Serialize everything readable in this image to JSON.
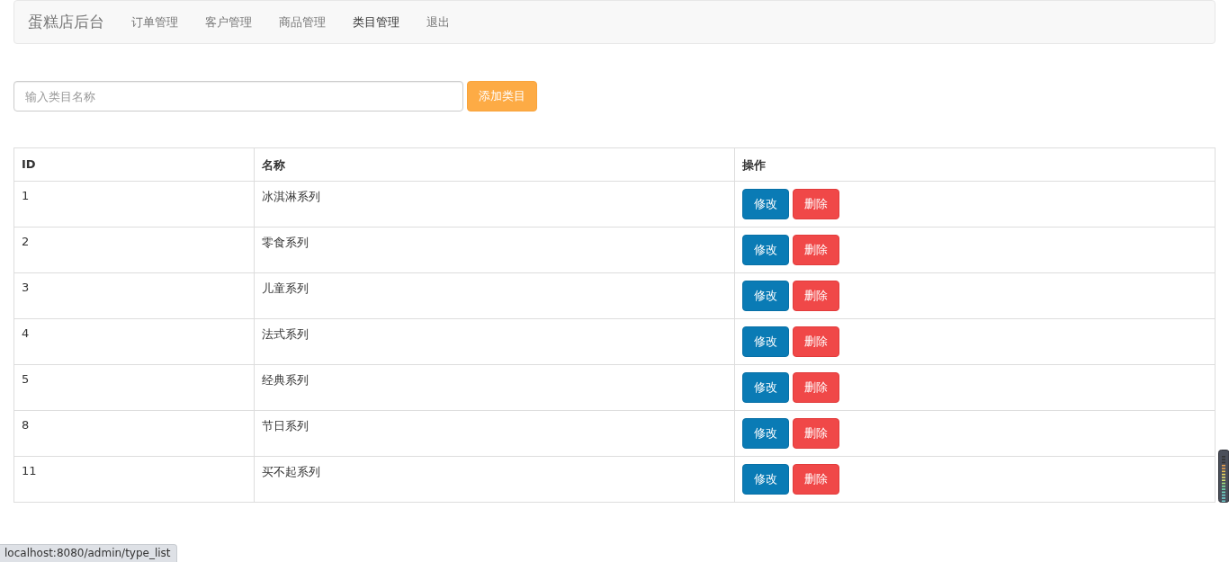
{
  "navbar": {
    "brand": "蛋糕店后台",
    "items": [
      {
        "label": "订单管理",
        "selected": false
      },
      {
        "label": "客户管理",
        "selected": false
      },
      {
        "label": "商品管理",
        "selected": false
      },
      {
        "label": "类目管理",
        "selected": true
      },
      {
        "label": "退出",
        "selected": false
      }
    ]
  },
  "add_form": {
    "placeholder": "输入类目名称",
    "button": "添加类目"
  },
  "table": {
    "columns": [
      "ID",
      "名称",
      "操作"
    ],
    "rows": [
      {
        "id": "1",
        "name": "冰淇淋系列",
        "actions": [
          "修改",
          "删除"
        ]
      },
      {
        "id": "2",
        "name": "零食系列",
        "actions": [
          "修改",
          "删除"
        ]
      },
      {
        "id": "3",
        "name": "儿童系列",
        "actions": [
          "修改",
          "删除"
        ]
      },
      {
        "id": "4",
        "name": "法式系列",
        "actions": [
          "修改",
          "删除"
        ]
      },
      {
        "id": "5",
        "name": "经典系列",
        "actions": [
          "修改",
          "删除"
        ]
      },
      {
        "id": "8",
        "name": "节日系列",
        "actions": [
          "修改",
          "删除"
        ]
      },
      {
        "id": "11",
        "name": "买不起系列",
        "actions": [
          "修改",
          "删除"
        ]
      }
    ]
  },
  "status_bar": {
    "url": "localhost:8080/admin/type_list"
  }
}
